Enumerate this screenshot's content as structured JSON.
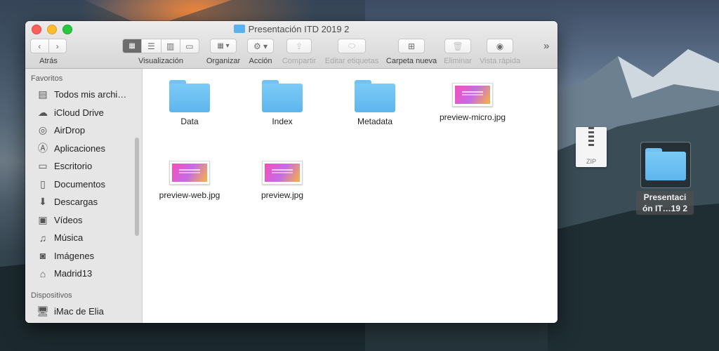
{
  "window": {
    "title": "Presentación ITD 2019 2"
  },
  "toolbar": {
    "back_label": "Atrás",
    "view_label": "Visualización",
    "arrange_label": "Organizar",
    "action_label": "Acción",
    "share_label": "Compartir",
    "tags_label": "Editar etiquetas",
    "newfolder_label": "Carpeta nueva",
    "delete_label": "Eliminar",
    "quicklook_label": "Vista rápida",
    "more_glyph": "»"
  },
  "sidebar": {
    "favorites_title": "Favoritos",
    "favorites": [
      {
        "label": "Todos mis archi…",
        "icon": "all-files-icon"
      },
      {
        "label": "iCloud Drive",
        "icon": "cloud-icon"
      },
      {
        "label": "AirDrop",
        "icon": "airdrop-icon"
      },
      {
        "label": "Aplicaciones",
        "icon": "applications-icon"
      },
      {
        "label": "Escritorio",
        "icon": "desktop-icon"
      },
      {
        "label": "Documentos",
        "icon": "documents-icon"
      },
      {
        "label": "Descargas",
        "icon": "downloads-icon"
      },
      {
        "label": "Vídeos",
        "icon": "movies-icon"
      },
      {
        "label": "Música",
        "icon": "music-icon"
      },
      {
        "label": "Imágenes",
        "icon": "pictures-icon"
      },
      {
        "label": "Madrid13",
        "icon": "home-icon"
      }
    ],
    "devices_title": "Dispositivos",
    "devices": [
      {
        "label": "iMac de Elia",
        "icon": "imac-icon"
      }
    ]
  },
  "files": [
    {
      "name": "Data",
      "type": "folder"
    },
    {
      "name": "Index",
      "type": "folder"
    },
    {
      "name": "Metadata",
      "type": "folder"
    },
    {
      "name": "preview-micro.jpg",
      "type": "image"
    },
    {
      "name": "preview-web.jpg",
      "type": "image"
    },
    {
      "name": "preview.jpg",
      "type": "image"
    }
  ],
  "desktop": {
    "zip_label": "ZIP",
    "folder_label_1": "Presentaci",
    "folder_label_2": "ón IT…19 2"
  },
  "colors": {
    "folder_blue": "#5eb6ee",
    "close": "#fc5f57",
    "minimize": "#fdbc2e",
    "maximize": "#28c840"
  }
}
